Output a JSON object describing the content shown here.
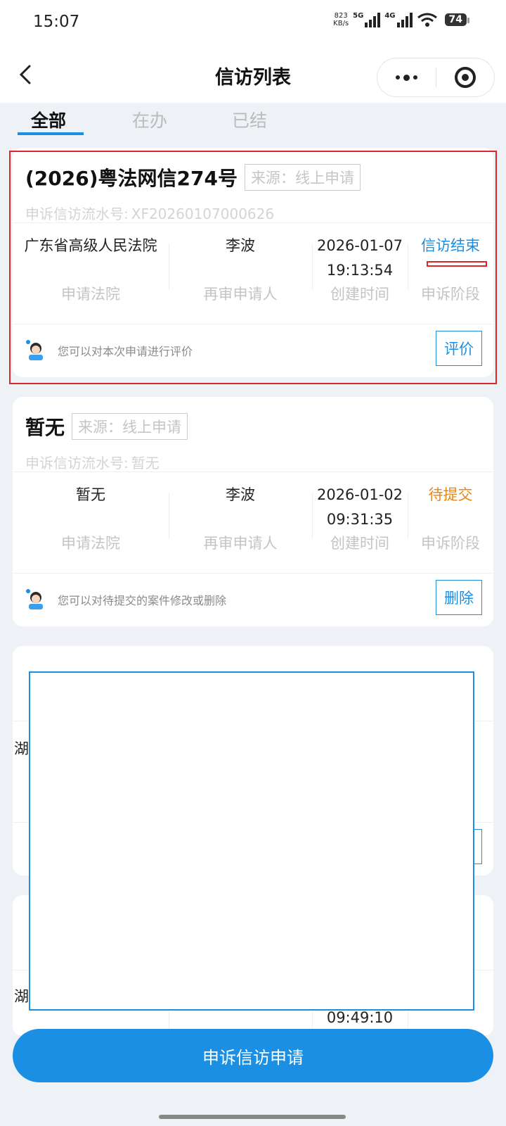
{
  "status_bar": {
    "time": "15:07",
    "net_speed_value": "823",
    "net_speed_unit": "KB/s",
    "sig1": "5G",
    "sig2": "4G",
    "battery": "74"
  },
  "nav": {
    "title": "信访列表"
  },
  "tabs": [
    {
      "label": "全部",
      "active": true
    },
    {
      "label": "在办"
    },
    {
      "label": "已结"
    }
  ],
  "cards": [
    {
      "title": "(2026)粤法网信274号",
      "source": "来源：线上申请",
      "serial_label": "申诉信访流水号:",
      "serial_value": "XF20260107000626",
      "court": "广东省高级人民法院",
      "applicant": "李波",
      "created_date": "2026-01-07",
      "created_time": "19:13:54",
      "stage": "信访结束",
      "labels": {
        "court": "申请法院",
        "applicant": "再审申请人",
        "created": "创建时间",
        "stage": "申诉阶段"
      },
      "tip": "您可以对本次申请进行评价",
      "action": "评价"
    },
    {
      "title": "暂无",
      "source": "来源：线上申请",
      "serial_label": "申诉信访流水号:",
      "serial_value": "暂无",
      "court": "暂无",
      "applicant": "李波",
      "created_date": "2026-01-02",
      "created_time": "09:31:35",
      "stage": "待提交",
      "labels": {
        "court": "申请法院",
        "applicant": "再审申请人",
        "created": "创建时间",
        "stage": "申诉阶段"
      },
      "tip": "您可以对待提交的案件修改或删除",
      "action": "删除"
    }
  ],
  "peek": {
    "court_char_3": "湖",
    "court_char_4": "湖",
    "time_4": "09:49:10"
  },
  "submit_button": "申诉信访申请",
  "colors": {
    "accent": "#1a8fe3",
    "stage_wait": "#e8861a",
    "highlight": "#d9262b"
  }
}
